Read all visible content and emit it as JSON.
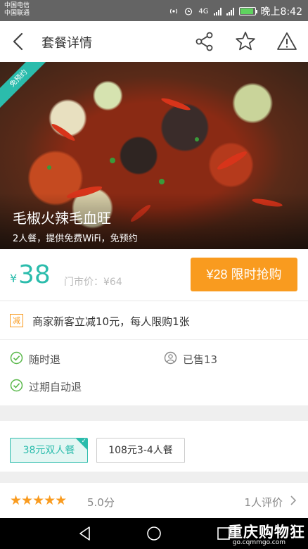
{
  "status_bar": {
    "carrier1": "中国电信",
    "carrier2": "中国联通",
    "network": "4G",
    "time": "晚上8:42",
    "battery_level": 0.9
  },
  "header": {
    "title": "套餐详情",
    "icons": [
      "back-icon",
      "share-icon",
      "star-icon",
      "warning-icon"
    ]
  },
  "hero": {
    "ribbon": "免预约",
    "dish_name": "毛椒火辣毛血旺",
    "subtitle": "2人餐，提供免费WiFi，免预约"
  },
  "price": {
    "currency": "¥",
    "current": "38",
    "market": "门市价：¥64",
    "buy_button": "¥28 限时抢购"
  },
  "info": {
    "promo_badge": "减",
    "promo_text": "商家新客立减10元，每人限购1张",
    "refund_anytime": "随时退",
    "sold": "已售13",
    "expire_refund": "过期自动退"
  },
  "options": [
    {
      "label": "38元双人餐",
      "selected": true
    },
    {
      "label": "108元3-4人餐",
      "selected": false
    }
  ],
  "rating": {
    "stars": 5,
    "score": "5.0分",
    "reviews": "1人评价"
  },
  "watermark": {
    "text": "重庆购物狂",
    "url": "go.cqmmgo.com"
  },
  "colors": {
    "accent": "#2bbcac",
    "orange": "#f99b1f",
    "status_bar": "#646464"
  }
}
